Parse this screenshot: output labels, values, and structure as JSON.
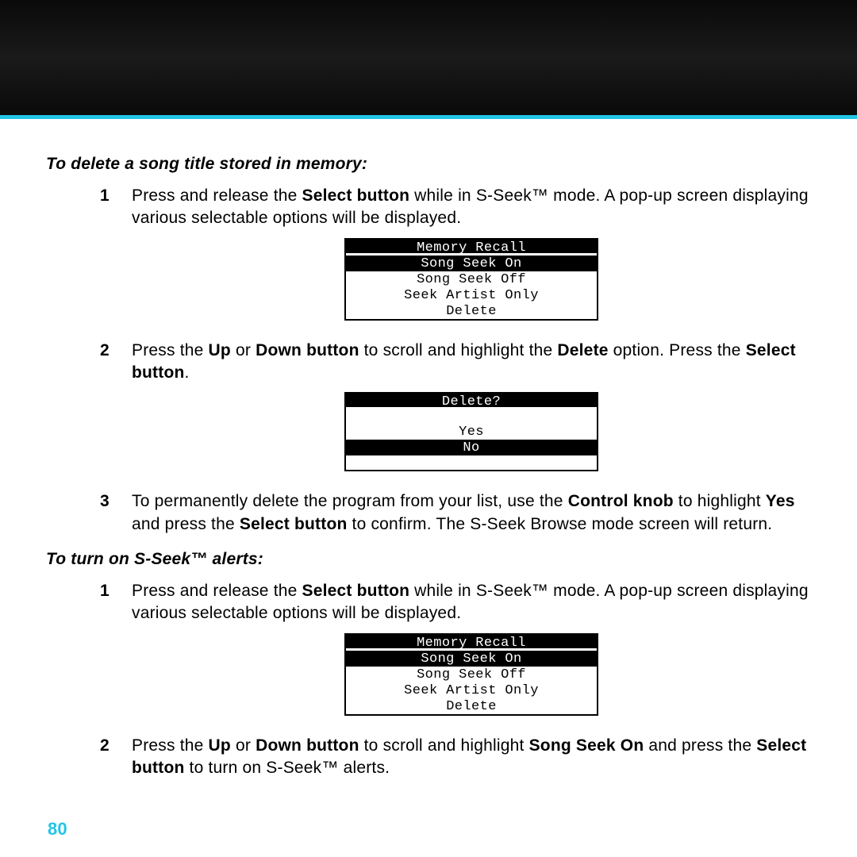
{
  "pageNumber": "80",
  "section1": {
    "title": "To delete a song title stored in memory:",
    "step1": {
      "num": "1",
      "pre": "Press and release the ",
      "b1": "Select button",
      "mid": " while in S-Seek™ mode.  A pop-up screen displaying various selectable options will be displayed."
    },
    "lcd1": {
      "header": "Memory Recall",
      "r1": "Song Seek On",
      "r2": "Song Seek Off",
      "r3": "Seek Artist Only",
      "r4": "Delete"
    },
    "step2": {
      "num": "2",
      "t1": "Press the ",
      "b1": "Up",
      "t2": " or ",
      "b2": "Down button",
      "t3": " to scroll and highlight the ",
      "b3": "Delete",
      "t4": " option. Press the ",
      "b4": "Select button",
      "t5": "."
    },
    "lcd2": {
      "header": "Delete?",
      "r1": "Yes",
      "r2": "No"
    },
    "step3": {
      "num": "3",
      "t1": "To permanently delete the program from your list, use the ",
      "b1": "Control knob",
      "t2": " to highlight ",
      "b2": "Yes",
      "t3": " and press the ",
      "b3": "Select button",
      "t4": " to confirm. The S-Seek Browse mode screen will return."
    }
  },
  "section2": {
    "title": "To turn on S-Seek™ alerts:",
    "step1": {
      "num": "1",
      "pre": "Press and release the ",
      "b1": "Select button",
      "mid": " while in S-Seek™ mode.  A pop-up screen displaying various selectable options will be displayed."
    },
    "lcd1": {
      "header": "Memory Recall",
      "r1": "Song Seek On",
      "r2": "Song Seek Off",
      "r3": "Seek Artist Only",
      "r4": "Delete"
    },
    "step2": {
      "num": "2",
      "t1": "Press the ",
      "b1": "Up",
      "t2": " or ",
      "b2": "Down button",
      "t3": " to scroll and highlight ",
      "b3": "Song Seek On",
      "t4": " and press the ",
      "b4": "Select button",
      "t5": " to turn on S-Seek™ alerts."
    }
  }
}
